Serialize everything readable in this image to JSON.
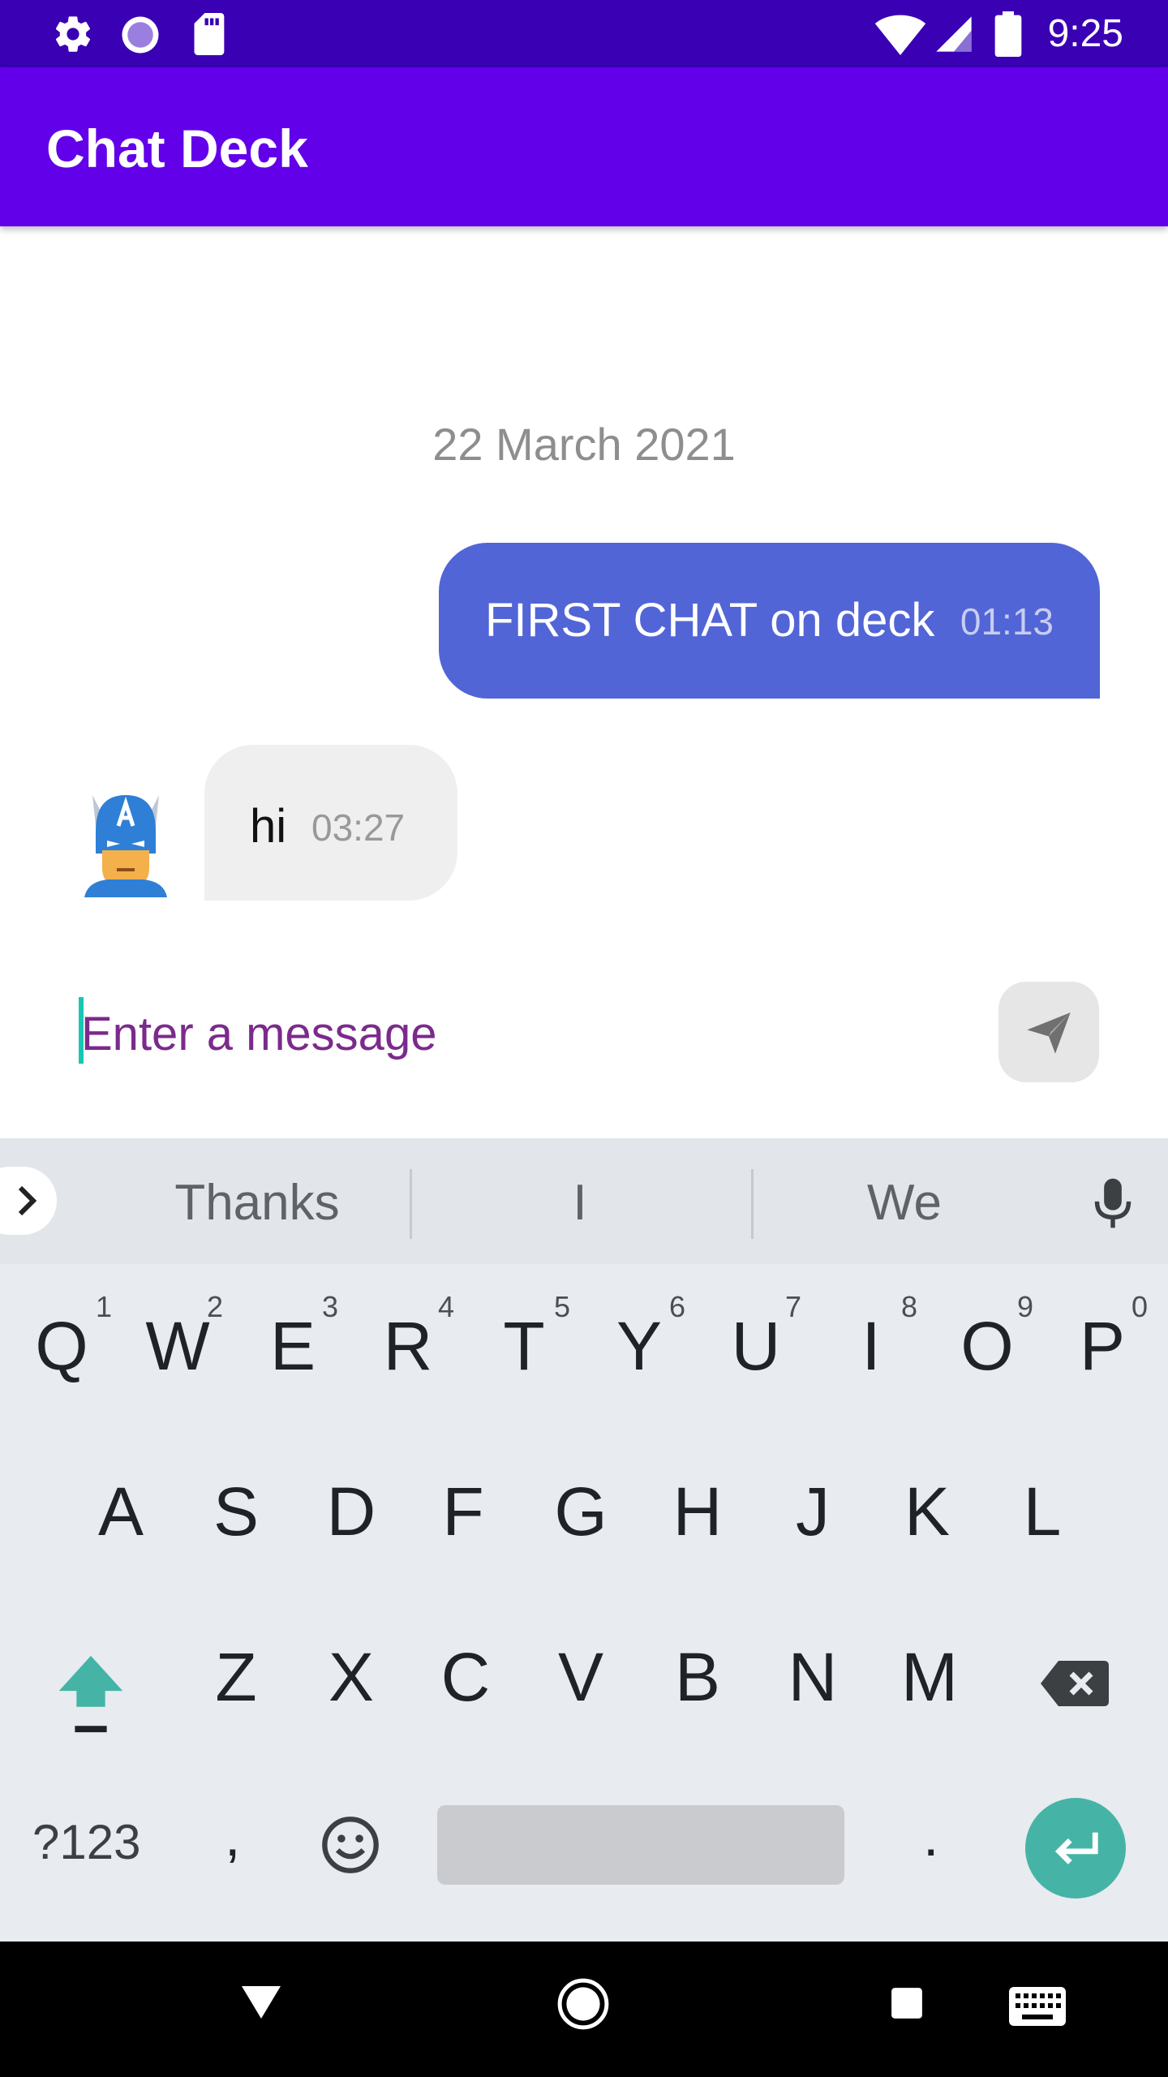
{
  "status_bar": {
    "time": "9:25"
  },
  "app_bar": {
    "title": "Chat Deck"
  },
  "chat": {
    "date": "22 March 2021",
    "messages": [
      {
        "text": "FIRST CHAT on deck",
        "time": "01:13"
      },
      {
        "text": "hi",
        "time": "03:27"
      }
    ]
  },
  "input": {
    "placeholder": "Enter a message"
  },
  "keyboard": {
    "suggestions": [
      "Thanks",
      "I",
      "We"
    ],
    "row1": [
      "Q",
      "W",
      "E",
      "R",
      "T",
      "Y",
      "U",
      "I",
      "O",
      "P"
    ],
    "row1_numbers": [
      "1",
      "2",
      "3",
      "4",
      "5",
      "6",
      "7",
      "8",
      "9",
      "0"
    ],
    "row2": [
      "A",
      "S",
      "D",
      "F",
      "G",
      "H",
      "J",
      "K",
      "L"
    ],
    "row3": [
      "Z",
      "X",
      "C",
      "V",
      "B",
      "N",
      "M"
    ],
    "symbols_label": "?123",
    "comma": ",",
    "period": "."
  },
  "colors": {
    "status_bar": "#3a00b3",
    "app_bar": "#6200ea",
    "sent_bubble": "#5265d6",
    "received_bubble": "#efefef",
    "accent": "#45b4a6"
  },
  "icons": [
    "settings-icon",
    "sync-icon",
    "sd-card-icon",
    "wifi-icon",
    "signal-icon",
    "battery-icon",
    "avatar",
    "send-icon",
    "chevron-right-icon",
    "mic-icon",
    "shift-icon",
    "backspace-icon",
    "emoji-icon",
    "enter-icon",
    "nav-back-icon",
    "nav-home-icon",
    "nav-recents-icon",
    "keyboard-icon"
  ]
}
